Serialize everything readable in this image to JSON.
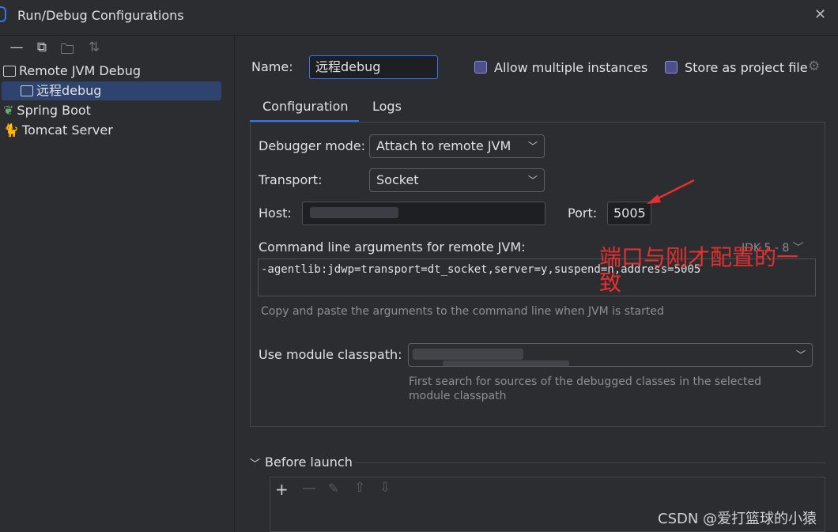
{
  "window": {
    "title": "Run/Debug Configurations"
  },
  "sidebar": {
    "toolbar": [
      "remove-icon",
      "copy-icon",
      "folder-icon",
      "sort-icon"
    ],
    "items": [
      {
        "label": "Remote JVM Debug"
      },
      {
        "label": "远程debug"
      },
      {
        "label": "Spring Boot"
      },
      {
        "label": "Tomcat Server"
      }
    ]
  },
  "form": {
    "name_label": "Name:",
    "name_value": "远程debug",
    "allow_multiple": "Allow multiple instances",
    "store_project": "Store as project file"
  },
  "tabs": [
    {
      "label": "Configuration"
    },
    {
      "label": "Logs"
    }
  ],
  "config": {
    "debugger_mode_label": "Debugger mode:",
    "debugger_mode_value": "Attach to remote JVM",
    "transport_label": "Transport:",
    "transport_value": "Socket",
    "host_label": "Host:",
    "port_label": "Port:",
    "port_value": "5005",
    "cmd_label": "Command line arguments for remote JVM:",
    "jdk_selector": "JDK 5 - 8",
    "cmd_value": "-agentlib:jdwp=transport=dt_socket,server=y,suspend=n,address=5005",
    "cmd_hint": "Copy and paste the arguments to the command line when JVM is started",
    "module_label": "Use module classpath:",
    "module_hint": "First search for sources of the debugged classes in the selected module classpath"
  },
  "before_launch": {
    "label": "Before launch"
  },
  "annotation": {
    "text_line1": "端口与刚才配置的一",
    "text_line2": "致",
    "color": "#e53030"
  },
  "watermark": "CSDN @爱打篮球的小猿",
  "colors": {
    "accent": "#3574f0",
    "background": "#2b2d30",
    "selection": "#2e436e"
  }
}
